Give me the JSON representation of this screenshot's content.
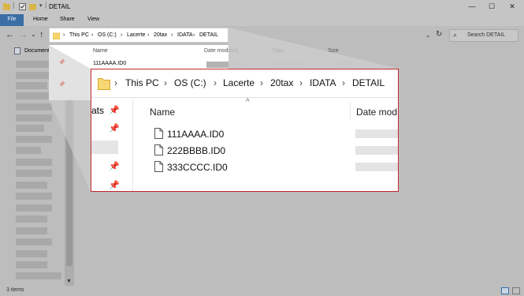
{
  "window": {
    "title": "DETAIL",
    "controls": {
      "minimize": "—",
      "maximize": "☐",
      "close": "✕"
    }
  },
  "ribbon": {
    "tabs": [
      "File",
      "Home",
      "Share",
      "View"
    ]
  },
  "nav": {
    "back": "←",
    "forward": "→",
    "dropdown": "⌄",
    "up": "↑",
    "recent": "⌄",
    "refresh": "↻"
  },
  "address": {
    "separator": "›",
    "segments": [
      "This PC",
      "OS (C:)",
      "Lacerte",
      "20tax",
      "IDATA",
      "DETAIL"
    ]
  },
  "search": {
    "placeholder": "Search DETAIL",
    "icon": "⌕"
  },
  "sidebar": {
    "pinned_item": "Documents",
    "pin_icon": "pushpin-icon"
  },
  "columns": {
    "name": "Name",
    "date_modified": "Date modified",
    "type": "Type",
    "size": "Size"
  },
  "files": [
    "111AAAA.ID0",
    "222BBBB.ID0",
    "333CCCC.ID0"
  ],
  "zoom_callout": {
    "left_pane_fragment": "ats",
    "name_header": "Name",
    "date_header": "Date mod",
    "sort_indicator": "^"
  },
  "status": {
    "item_count": "3 items"
  },
  "colors": {
    "callout_border": "#c0282d",
    "file_tab": "#3a6ea5",
    "folder": "#f6d66c"
  }
}
